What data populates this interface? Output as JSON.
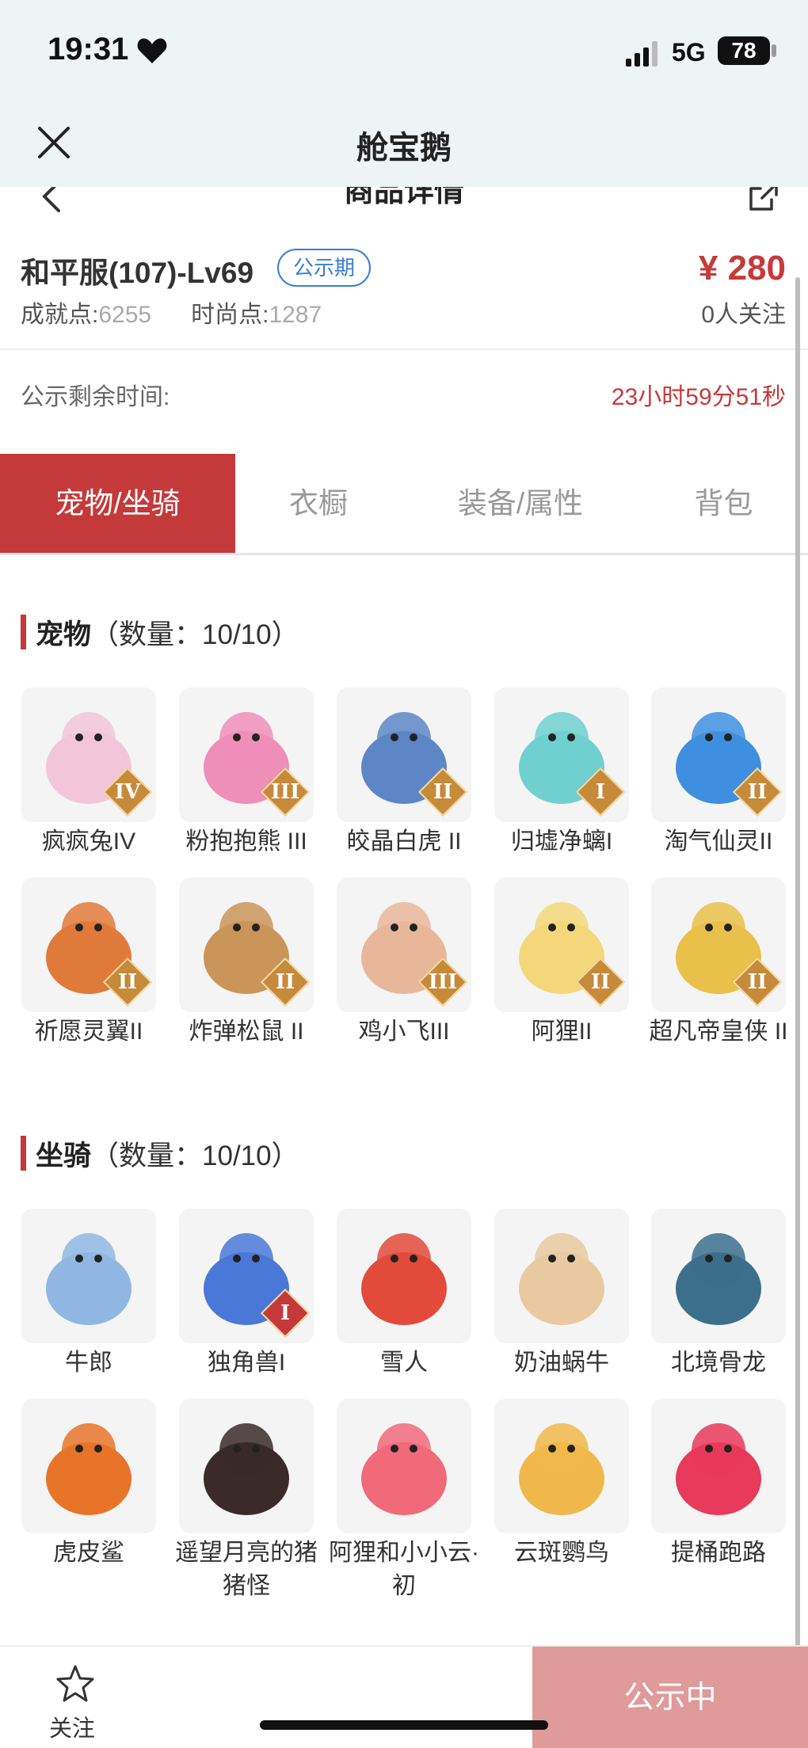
{
  "status_bar": {
    "time": "19:31",
    "network": "5G",
    "battery": "78"
  },
  "header": {
    "app_title": "舱宝鹅",
    "page_title": "商品详情"
  },
  "product": {
    "name": "和平服(107)-Lv69",
    "badge": "公示期",
    "price": "¥ 280",
    "achievement_label": "成就点:",
    "achievement_value": "6255",
    "fashion_label": "时尚点:",
    "fashion_value": "1287",
    "followers": "0人关注"
  },
  "countdown": {
    "label": "公示剩余时间:",
    "value": "23小时59分51秒"
  },
  "tabs": [
    {
      "label": "宠物/坐骑"
    },
    {
      "label": "衣橱"
    },
    {
      "label": "装备/属性"
    },
    {
      "label": "背包"
    }
  ],
  "pets": {
    "title": "宠物",
    "count": "（数量：10/10）",
    "items": [
      {
        "name": "疯疯兔IV",
        "rank": "IV",
        "icon": "bunny-pet-icon",
        "color": "#f2c6d8"
      },
      {
        "name": "粉抱抱熊 III",
        "rank": "III",
        "icon": "bear-pet-icon",
        "color": "#ee8fb8"
      },
      {
        "name": "皎晶白虎 II",
        "rank": "II",
        "icon": "tiger-pet-icon",
        "color": "#5d86c6"
      },
      {
        "name": "归墟净螭I",
        "rank": "I",
        "icon": "dragon-pet-icon",
        "color": "#6fd0cf"
      },
      {
        "name": "淘气仙灵II",
        "rank": "II",
        "icon": "blue-puppy-pet-icon",
        "color": "#3f8fe0"
      },
      {
        "name": "祈愿灵翼II",
        "rank": "II",
        "icon": "bird-pet-icon",
        "color": "#e07a3a"
      },
      {
        "name": "炸弹松鼠 II",
        "rank": "II",
        "icon": "squirrel-pet-icon",
        "color": "#c99558"
      },
      {
        "name": "鸡小飞III",
        "rank": "III",
        "icon": "chick-pet-icon",
        "color": "#e8b79a"
      },
      {
        "name": "阿狸II",
        "rank": "II",
        "icon": "fox-pet-icon",
        "color": "#f3d77a"
      },
      {
        "name": "超凡帝皇侠 II",
        "rank": "II",
        "icon": "warrior-pet-icon",
        "color": "#e8c04a"
      }
    ]
  },
  "mounts": {
    "title": "坐骑",
    "count": "（数量：10/10）",
    "items": [
      {
        "name": "牛郎",
        "rank": "",
        "icon": "ox-mount-icon",
        "color": "#8fb7e2"
      },
      {
        "name": "独角兽I",
        "rank": "I",
        "icon": "unicorn-mount-icon",
        "color": "#4a78d8"
      },
      {
        "name": "雪人",
        "rank": "",
        "icon": "snowman-mount-icon",
        "color": "#e24a3a"
      },
      {
        "name": "奶油蜗牛",
        "rank": "",
        "icon": "snail-mount-icon",
        "color": "#e9c9a0"
      },
      {
        "name": "北境骨龙",
        "rank": "",
        "icon": "bone-dragon-mount-icon",
        "color": "#3c6f8c"
      },
      {
        "name": "虎皮鲨",
        "rank": "",
        "icon": "shark-mount-icon",
        "color": "#e8742a"
      },
      {
        "name": "遥望月亮的猪猪怪",
        "rank": "",
        "icon": "pig-mount-icon",
        "color": "#3a2a2a"
      },
      {
        "name": "阿狸和小小云·初",
        "rank": "",
        "icon": "fox-cloud-mount-icon",
        "color": "#f06a7a"
      },
      {
        "name": "云斑鹦鸟",
        "rank": "",
        "icon": "parrot-mount-icon",
        "color": "#f0b84a"
      },
      {
        "name": "提桶跑路",
        "rank": "",
        "icon": "bucket-mount-icon",
        "color": "#e83a5a"
      }
    ]
  },
  "bottom_bar": {
    "follow_label": "关注",
    "status_label": "公示中"
  }
}
